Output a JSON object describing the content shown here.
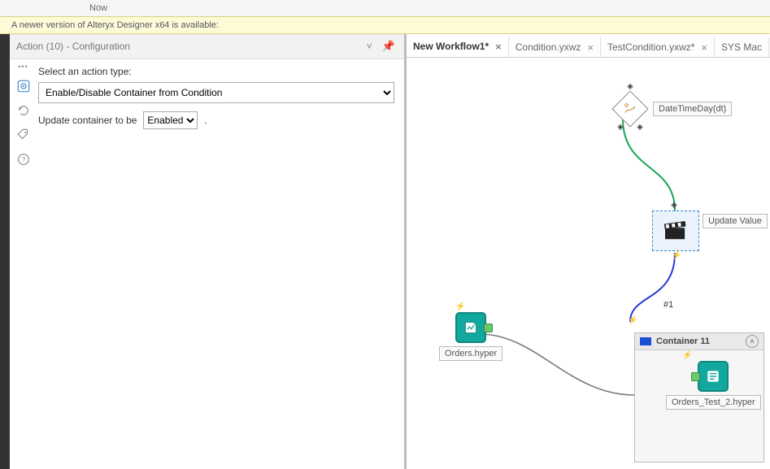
{
  "overbar_text": "Now",
  "notification": "A newer version of Alteryx Designer x64 is available:",
  "config": {
    "title": "Action (10) - Configuration",
    "label_action_type": "Select an action type:",
    "action_type_value": "Enable/Disable Container from Condition",
    "label_update": "Update container to be",
    "update_value": "Enabled",
    "trailing_dot": "."
  },
  "tabs": [
    {
      "label": "New Workflow1*",
      "active": true,
      "closable": true
    },
    {
      "label": "Condition.yxwz",
      "active": false,
      "closable": true
    },
    {
      "label": "TestCondition.yxwz*",
      "active": false,
      "closable": true
    },
    {
      "label": "SYS Mac",
      "active": false,
      "closable": false
    }
  ],
  "canvas": {
    "condition_label": "DateTimeDay(dt)",
    "action_label": "Update Value",
    "connection_label": "#1",
    "input_tool_label": "Orders.hyper",
    "container_title": "Container 11",
    "output_tool_label": "Orders_Test_2.hyper"
  }
}
